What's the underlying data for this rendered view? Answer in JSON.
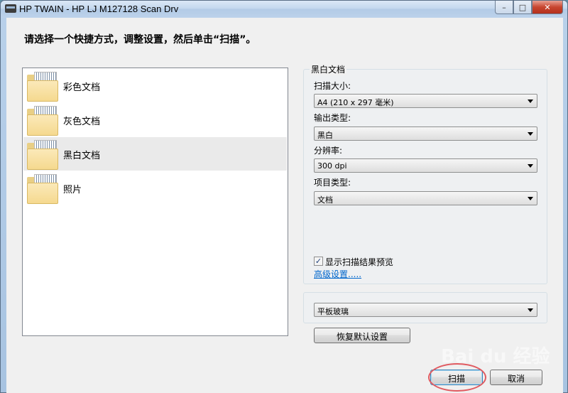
{
  "window": {
    "title": "HP TWAIN - HP LJ M127128 Scan Drv",
    "minimize": "–",
    "maximize": "□",
    "close": "✕"
  },
  "instruction": "请选择一个快捷方式，调整设置，然后单击“扫描”。",
  "shortcuts": [
    {
      "label": "彩色文档",
      "selected": false
    },
    {
      "label": "灰色文档",
      "selected": false
    },
    {
      "label": "黑白文档",
      "selected": true
    },
    {
      "label": "照片",
      "selected": false
    }
  ],
  "settings": {
    "group_title": "黑白文档",
    "scan_size_label": "扫描大小:",
    "scan_size_value": "A4 (210 x 297 毫米)",
    "output_type_label": "输出类型:",
    "output_type_value": "黑白",
    "resolution_label": "分辨率:",
    "resolution_value": "300 dpi",
    "item_type_label": "项目类型:",
    "item_type_value": "文档",
    "preview_checkbox_label": "显示扫描结果预览",
    "preview_checked": true,
    "advanced_link": "高级设置....."
  },
  "source": {
    "value": "平板玻璃"
  },
  "buttons": {
    "restore_defaults": "恢复默认设置",
    "scan": "扫描",
    "cancel": "取消"
  },
  "watermark": "Bai du 经验"
}
